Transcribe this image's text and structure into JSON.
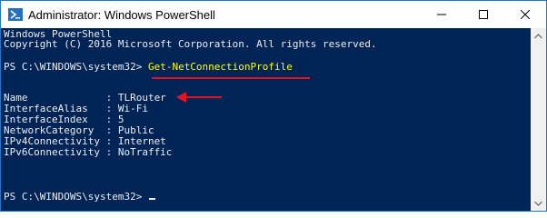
{
  "window": {
    "title": "Administrator: Windows PowerShell"
  },
  "console": {
    "header_line1": "Windows PowerShell",
    "header_line2": "Copyright (C) 2016 Microsoft Corporation. All rights reserved.",
    "prompt1": "PS C:\\WINDOWS\\system32> ",
    "command": "Get-NetConnectionProfile",
    "output": [
      "Name             : TLRouter",
      "InterfaceAlias   : Wi-Fi",
      "InterfaceIndex   : 5",
      "NetworkCategory  : Public",
      "IPv4Connectivity : Internet",
      "IPv6Connectivity : NoTraffic"
    ],
    "prompt2": "PS C:\\WINDOWS\\system32> "
  },
  "colors": {
    "background": "#012456",
    "text": "#eeedf0",
    "command": "#ffff00",
    "annotation": "#e81123"
  },
  "icons": {
    "app": "powershell-icon",
    "minimize": "minimize-icon",
    "maximize": "maximize-icon",
    "close": "close-icon"
  }
}
